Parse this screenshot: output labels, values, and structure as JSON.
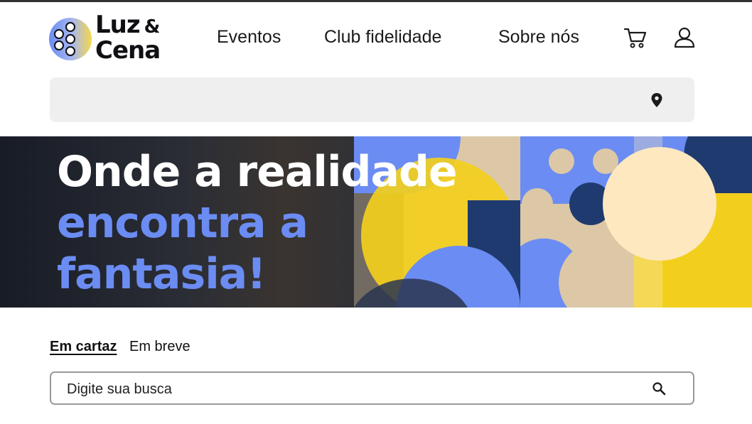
{
  "brand": {
    "line1": "Luz",
    "amp": "&",
    "line2": "Cena",
    "colors": {
      "blue": "#6b8cf2",
      "yellow": "#f2cf1d",
      "dark": "#0f0f14"
    }
  },
  "nav": {
    "items": [
      {
        "label": "Eventos"
      },
      {
        "label": "Club fidelidade"
      },
      {
        "label": "Sobre nós"
      }
    ],
    "cart_icon": "cart-icon",
    "user_icon": "user-icon"
  },
  "location": {
    "icon": "location-pin-icon",
    "value": ""
  },
  "hero": {
    "line1": "Onde a realidade",
    "line2": "encontra a",
    "line3": "fantasia!",
    "colors": {
      "white": "#ffffff",
      "accent": "#6b8cf2",
      "yellow": "#f2cf1d",
      "navy": "#1f3a6e",
      "cream": "#fde8c0"
    }
  },
  "tabs": [
    {
      "label": "Em cartaz",
      "active": true
    },
    {
      "label": "Em breve",
      "active": false
    }
  ],
  "search": {
    "placeholder": "Digite sua busca",
    "value": "",
    "icon": "search-icon"
  }
}
